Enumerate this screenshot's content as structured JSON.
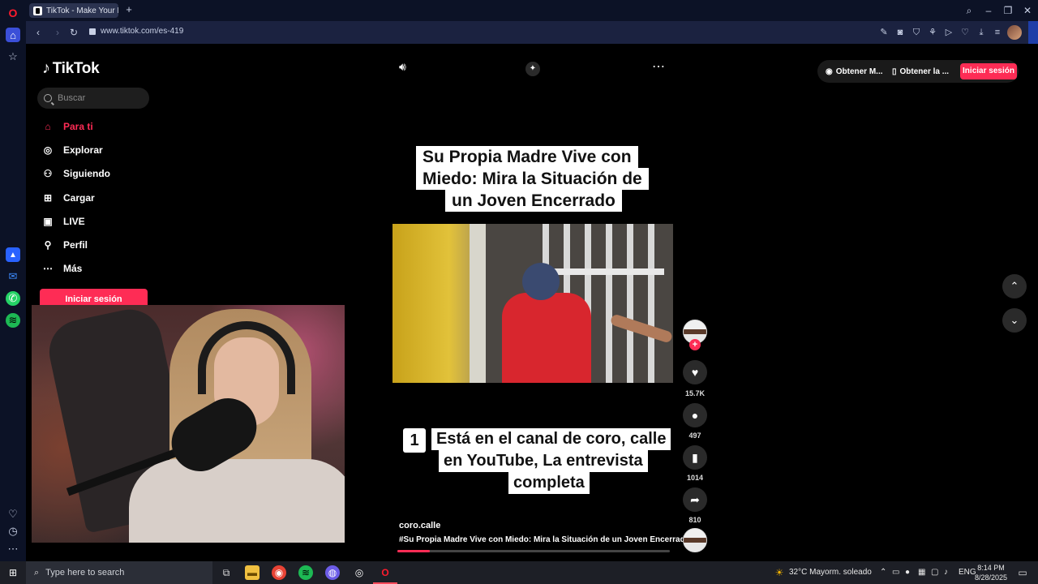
{
  "browser": {
    "tab_title": "TikTok - Make Your Da",
    "tab_close": "×",
    "new_tab": "+",
    "url": "www.tiktok.com/es-419"
  },
  "sidebar_nav": {
    "logo_text": "TikTok",
    "search_placeholder": "Buscar",
    "items": [
      {
        "label": "Para ti",
        "icon": "home-icon",
        "active": true
      },
      {
        "label": "Explorar",
        "icon": "compass-icon"
      },
      {
        "label": "Siguiendo",
        "icon": "following-icon"
      },
      {
        "label": "Cargar",
        "icon": "upload-icon"
      },
      {
        "label": "LIVE",
        "icon": "live-icon"
      },
      {
        "label": "Perfil",
        "icon": "profile-icon"
      },
      {
        "label": "Más",
        "icon": "more-icon"
      }
    ],
    "login_label": "Iniciar sesión"
  },
  "header": {
    "get_coins": "Obtener M...",
    "get_app": "Obtener la ...",
    "login_label": "Iniciar sesión"
  },
  "video": {
    "title_lines": [
      "Su Propia Madre Vive con",
      "Miedo: Mira la Situación de",
      "un Joven Encerrado"
    ],
    "caption_number": "1",
    "caption_lines": [
      "Está en el canal de coro, calle",
      "en YouTube, La entrevista",
      "completa"
    ],
    "author": "coro.calle",
    "description": "#Su  Propia Madre Vive con Miedo: Mira la Situación de un Joven Encerrado",
    "progress": 0.12
  },
  "actions": {
    "likes": "15.7K",
    "comments": "497",
    "saves": "1014",
    "shares": "810"
  },
  "taskbar": {
    "search_placeholder": "Type here to search",
    "weather": "32°C  Mayorm. soleado",
    "language": "ENG",
    "time": "8:14 PM",
    "date": "8/28/2025"
  },
  "colors": {
    "accent": "#fe2c55",
    "browser_bg": "#0c1226"
  }
}
